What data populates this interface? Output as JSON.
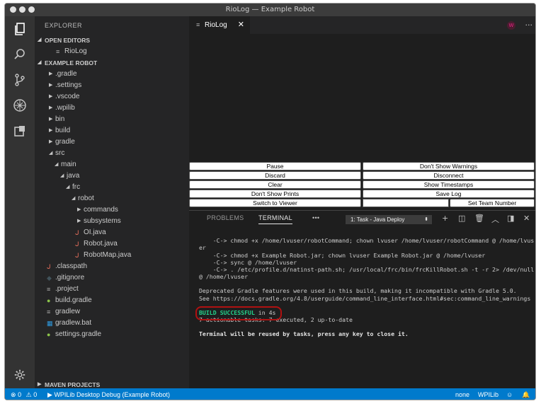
{
  "window": {
    "title": "RioLog — Example Robot"
  },
  "activitybar": {
    "icons": [
      "files-icon",
      "search-icon",
      "source-control-icon",
      "debug-icon",
      "extensions-icon",
      "gear-icon"
    ]
  },
  "sidebar": {
    "title": "EXPLORER",
    "open_editors_header": "OPEN EDITORS",
    "open_editors": [
      {
        "label": "RioLog"
      }
    ],
    "project_header": "EXAMPLE ROBOT",
    "tree": [
      {
        "label": ".gradle",
        "type": "folder",
        "level": 0,
        "expanded": false
      },
      {
        "label": ".settings",
        "type": "folder",
        "level": 0,
        "expanded": false
      },
      {
        "label": ".vscode",
        "type": "folder",
        "level": 0,
        "expanded": false
      },
      {
        "label": ".wpilib",
        "type": "folder",
        "level": 0,
        "expanded": false
      },
      {
        "label": "bin",
        "type": "folder",
        "level": 0,
        "expanded": false
      },
      {
        "label": "build",
        "type": "folder",
        "level": 0,
        "expanded": false
      },
      {
        "label": "gradle",
        "type": "folder",
        "level": 0,
        "expanded": false
      },
      {
        "label": "src",
        "type": "folder",
        "level": 0,
        "expanded": true
      },
      {
        "label": "main",
        "type": "folder",
        "level": 1,
        "expanded": true
      },
      {
        "label": "java",
        "type": "folder",
        "level": 2,
        "expanded": true
      },
      {
        "label": "frc",
        "type": "folder",
        "level": 3,
        "expanded": true
      },
      {
        "label": "robot",
        "type": "folder",
        "level": 4,
        "expanded": true
      },
      {
        "label": "commands",
        "type": "folder",
        "level": 5,
        "expanded": false
      },
      {
        "label": "subsystems",
        "type": "folder",
        "level": 5,
        "expanded": false
      },
      {
        "label": "OI.java",
        "type": "java",
        "level": 5
      },
      {
        "label": "Robot.java",
        "type": "java",
        "level": 5
      },
      {
        "label": "RobotMap.java",
        "type": "java",
        "level": 5
      },
      {
        "label": ".classpath",
        "type": "java",
        "level": 0
      },
      {
        "label": ".gitignore",
        "type": "git",
        "level": 0
      },
      {
        "label": ".project",
        "type": "text",
        "level": 0
      },
      {
        "label": "build.gradle",
        "type": "gradle",
        "level": 0
      },
      {
        "label": "gradlew",
        "type": "text",
        "level": 0
      },
      {
        "label": "gradlew.bat",
        "type": "windows",
        "level": 0
      },
      {
        "label": "settings.gradle",
        "type": "gradle",
        "level": 0
      }
    ],
    "maven_header": "MAVEN PROJECTS"
  },
  "editor": {
    "tab_label": "RioLog",
    "tab_close": "✕",
    "badge": "W",
    "more": "···"
  },
  "riolog": {
    "buttons": {
      "pause": "Pause",
      "dont_show_warnings": "Don't Show Warnings",
      "discard": "Discard",
      "disconnect": "Disconnect",
      "clear": "Clear",
      "show_timestamps": "Show Timestamps",
      "dont_show_prints": "Don't Show Prints",
      "save_log": "Save Log",
      "switch_to_viewer": "Switch to Viewer",
      "set_team_number": "Set Team Number"
    }
  },
  "panel": {
    "tabs": {
      "problems": "PROBLEMS",
      "terminal": "TERMINAL",
      "more": "•••"
    },
    "task_select": "1: Task - Java Deploy",
    "terminal_lines": {
      "l1": "    -C-> chmod +x /home/lvuser/robotCommand; chown lvuser /home/lvuser/robotCommand @ /home/lvuser",
      "l2": "    -C-> chmod +x Example Robot.jar; chown lvuser Example Robot.jar @ /home/lvuser",
      "l3": "    -C-> sync @ /home/lvuser",
      "l4": "    -C-> . /etc/profile.d/natinst-path.sh; /usr/local/frc/bin/frcKillRobot.sh -t -r 2> /dev/null @ /home/lvuser",
      "l5": "Deprecated Gradle features were used in this build, making it incompatible with Gradle 5.0.",
      "l6": "See https://docs.gradle.org/4.8/userguide/command_line_interface.html#sec:command_line_warnings",
      "build_success": "BUILD SUCCESSFUL",
      "build_time": " in 4s",
      "l8": "7 actionable tasks: 7 executed, 2 up-to-date",
      "l9": "Terminal will be reused by tasks, press any key to close it."
    }
  },
  "statusbar": {
    "errors": "0",
    "warnings": "0",
    "debug_config": "WPILib Desktop Debug (Example Robot)",
    "none": "none",
    "wpilib": "WPILib"
  },
  "colors": {
    "statusbar": "#007acc",
    "success": "#23d18b",
    "annotation": "#b01111"
  }
}
